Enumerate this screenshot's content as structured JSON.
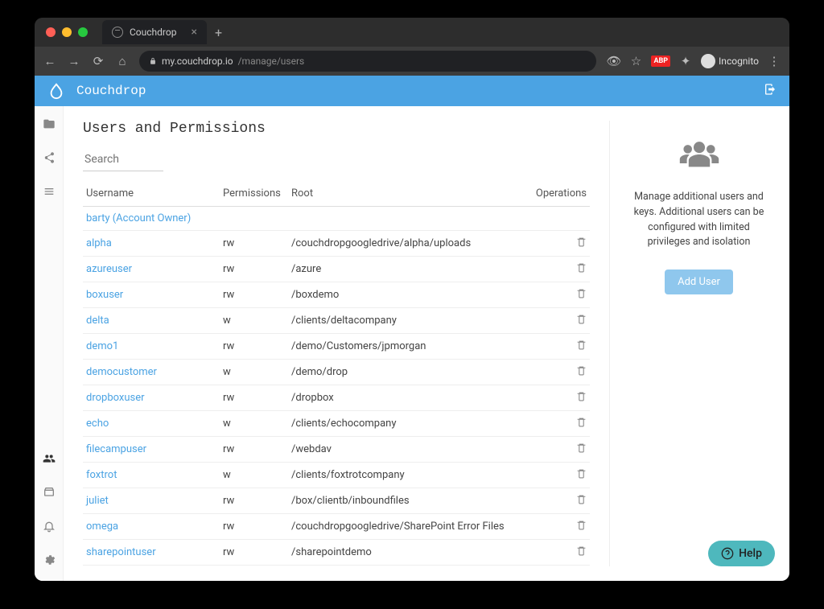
{
  "browser": {
    "tab_title": "Couchdrop",
    "url_host": "my.couchdrop.io",
    "url_path": "/manage/users",
    "incognito_label": "Incognito"
  },
  "header": {
    "brand": "Couchdrop"
  },
  "page": {
    "title": "Users and Permissions",
    "search_placeholder": "Search",
    "columns": {
      "username": "Username",
      "permissions": "Permissions",
      "root": "Root",
      "operations": "Operations"
    },
    "users": [
      {
        "username": "barty (Account Owner)",
        "permissions": "",
        "root": "",
        "deletable": false
      },
      {
        "username": "alpha",
        "permissions": "rw",
        "root": "/couchdropgoogledrive/alpha/uploads",
        "deletable": true
      },
      {
        "username": "azureuser",
        "permissions": "rw",
        "root": "/azure",
        "deletable": true
      },
      {
        "username": "boxuser",
        "permissions": "rw",
        "root": "/boxdemo",
        "deletable": true
      },
      {
        "username": "delta",
        "permissions": "w",
        "root": "/clients/deltacompany",
        "deletable": true
      },
      {
        "username": "demo1",
        "permissions": "rw",
        "root": "/demo/Customers/jpmorgan",
        "deletable": true
      },
      {
        "username": "democustomer",
        "permissions": "w",
        "root": "/demo/drop",
        "deletable": true
      },
      {
        "username": "dropboxuser",
        "permissions": "rw",
        "root": "/dropbox",
        "deletable": true
      },
      {
        "username": "echo",
        "permissions": "w",
        "root": "/clients/echocompany",
        "deletable": true
      },
      {
        "username": "filecampuser",
        "permissions": "rw",
        "root": "/webdav",
        "deletable": true
      },
      {
        "username": "foxtrot",
        "permissions": "w",
        "root": "/clients/foxtrotcompany",
        "deletable": true
      },
      {
        "username": "juliet",
        "permissions": "rw",
        "root": "/box/clientb/inboundfiles",
        "deletable": true
      },
      {
        "username": "omega",
        "permissions": "rw",
        "root": "/couchdropgoogledrive/SharePoint Error Files",
        "deletable": true
      },
      {
        "username": "sharepointuser",
        "permissions": "rw",
        "root": "/sharepointdemo",
        "deletable": true
      }
    ]
  },
  "sidebar": {
    "help_text": "Manage additional users and keys. Additional users can be configured with limited privileges and isolation",
    "add_user_label": "Add User"
  },
  "help_button": "Help"
}
